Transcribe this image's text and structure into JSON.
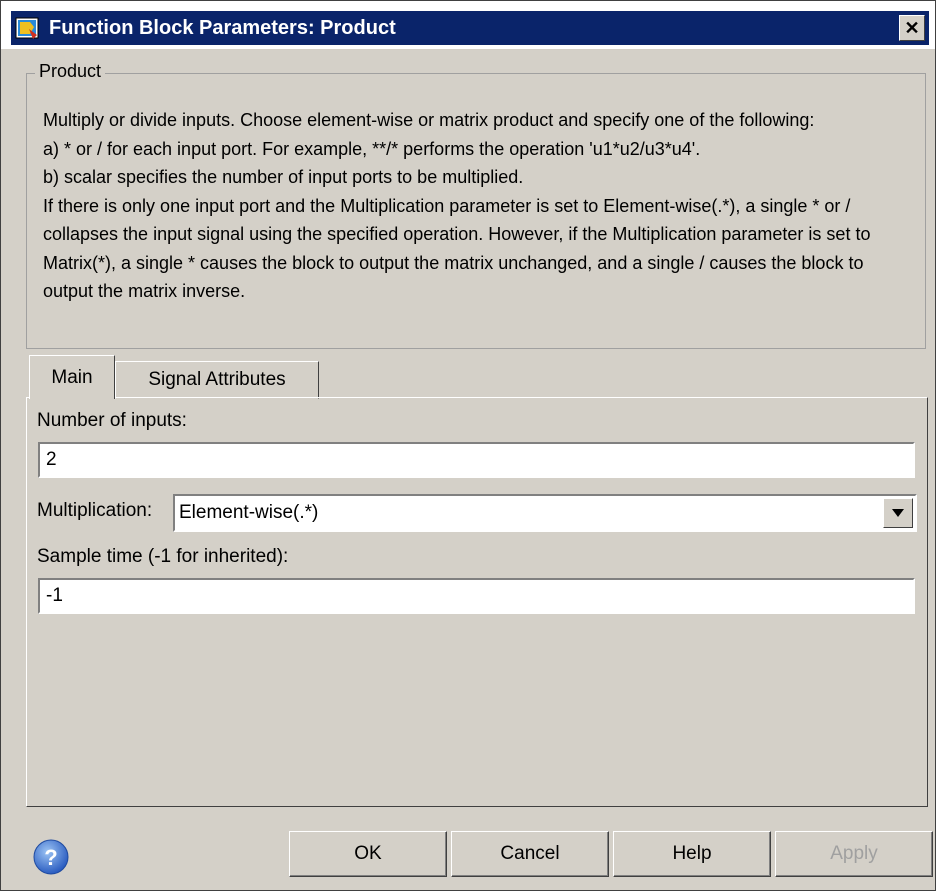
{
  "window": {
    "title": "Function Block Parameters: Product",
    "close_label": "✕"
  },
  "group": {
    "legend": "Product",
    "description": "Multiply or divide inputs.  Choose element-wise or matrix product and specify one of the following:\n a) * or / for each input port. For example, **/* performs the operation 'u1*u2/u3*u4'.\n b) scalar specifies the number of input ports to be multiplied.\nIf there is only one input port and the Multiplication parameter is set to Element-wise(.*), a single * or / collapses the input signal using the specified operation. However, if the Multiplication parameter is set to Matrix(*), a single * causes the block to output the matrix unchanged, and a single / causes the block to output the matrix inverse."
  },
  "tabs": [
    {
      "label": "Main",
      "active": true
    },
    {
      "label": "Signal Attributes",
      "active": false
    }
  ],
  "main": {
    "num_inputs_label": "Number of inputs:",
    "num_inputs_value": "2",
    "multiplication_label": "Multiplication:",
    "multiplication_value": "Element-wise(.*)",
    "sample_time_label": "Sample time (-1 for inherited):",
    "sample_time_value": "-1"
  },
  "buttons": {
    "ok": "OK",
    "cancel": "Cancel",
    "help": "Help",
    "apply": "Apply"
  },
  "colors": {
    "titlebar": "#0a246a",
    "dialog_bg": "#d4d0c8",
    "help_icon": "#3a6fd0"
  },
  "icons": {
    "app": "simulink-block-icon",
    "help": "question-mark-icon",
    "dropdown": "triangle-down-icon"
  }
}
